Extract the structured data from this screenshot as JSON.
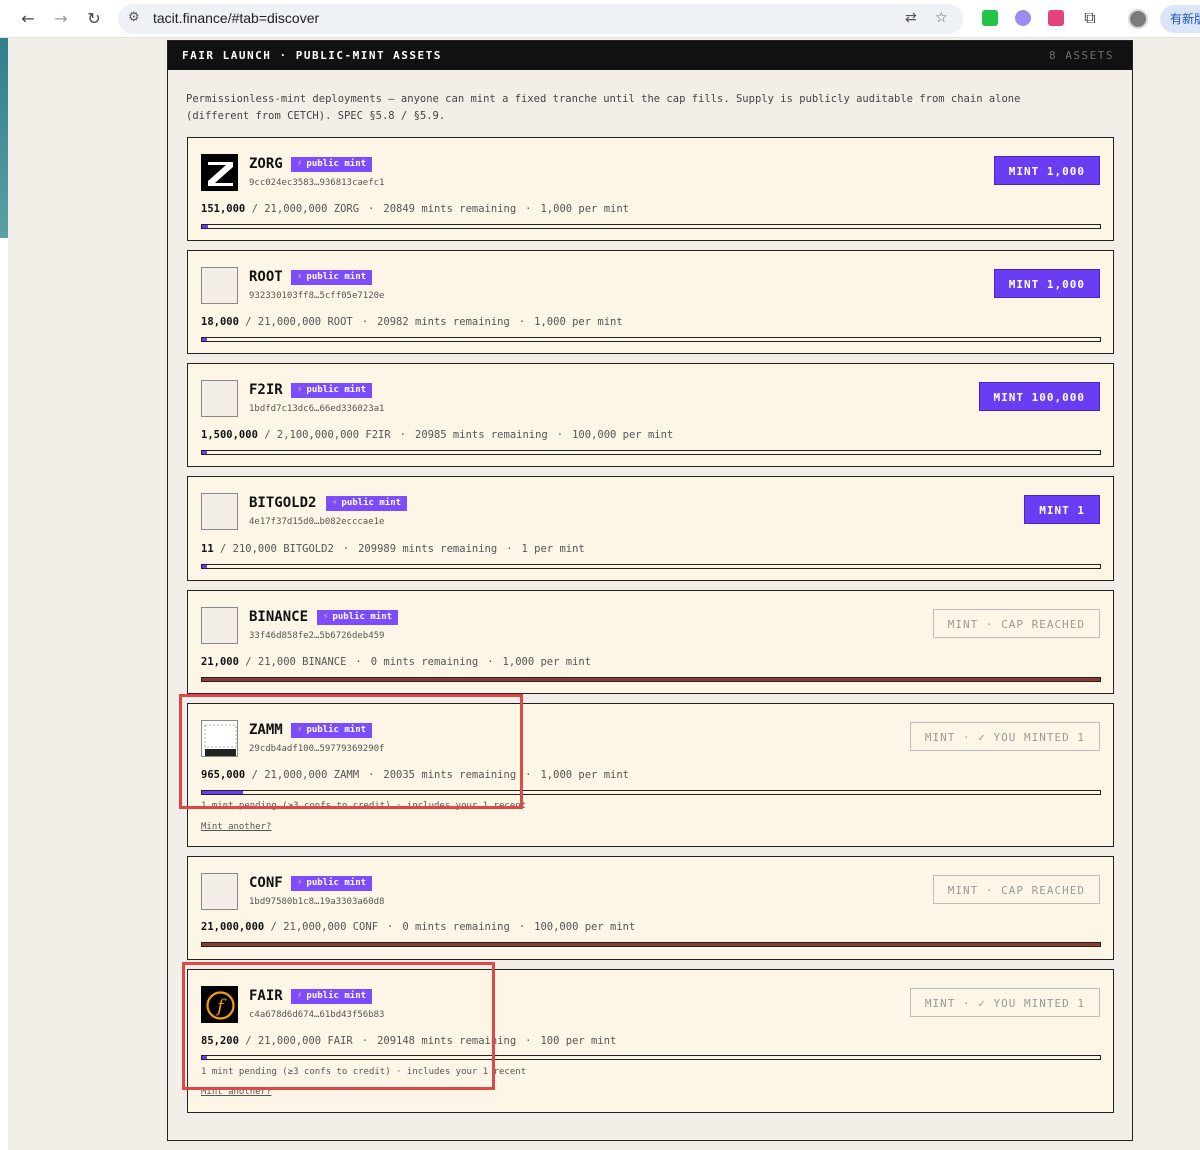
{
  "browser": {
    "url": "tacit.finance/#tab=discover",
    "update_label": "有新版"
  },
  "panel": {
    "title": "FAIR LAUNCH · PUBLIC-MINT ASSETS",
    "count": "8 ASSETS",
    "intro": "Permissionless-mint deployments — anyone can mint a fixed tranche until the cap fills. Supply is publicly auditable from chain alone (different from CETCH). SPEC §5.8 / §5.9."
  },
  "badge_label": "public mint",
  "assets": [
    {
      "ticker": "ZORG",
      "txid": "9cc024ec3583…936813caefc1",
      "minted": "151,000",
      "supply": "/ 21,000,000 ZORG",
      "remaining": "20849 mints remaining",
      "per_mint": "1,000 per mint",
      "button": "MINT 1,000",
      "progress": 0.0072,
      "state": "open"
    },
    {
      "ticker": "ROOT",
      "txid": "932330103ff8…5cff05e7120e",
      "minted": "18,000",
      "supply": "/ 21,000,000 ROOT",
      "remaining": "20982 mints remaining",
      "per_mint": "1,000 per mint",
      "button": "MINT 1,000",
      "progress": 0.0009,
      "state": "open"
    },
    {
      "ticker": "F2IR",
      "txid": "1bdfd7c13dc6…66ed336023a1",
      "minted": "1,500,000",
      "supply": "/ 2,100,000,000 F2IR",
      "remaining": "20985 mints remaining",
      "per_mint": "100,000 per mint",
      "button": "MINT 100,000",
      "progress": 0.0007,
      "state": "open"
    },
    {
      "ticker": "BITGOLD2",
      "txid": "4e17f37d15d0…b082ecccae1e",
      "minted": "11",
      "supply": "/ 210,000 BITGOLD2",
      "remaining": "209989 mints remaining",
      "per_mint": "1 per mint",
      "button": "MINT 1",
      "progress": 0.0001,
      "state": "open"
    },
    {
      "ticker": "BINANCE",
      "txid": "33f46d858fe2…5b6726deb459",
      "minted": "21,000",
      "supply": "/ 21,000 BINANCE",
      "remaining": "0 mints remaining",
      "per_mint": "1,000 per mint",
      "button": "MINT · CAP REACHED",
      "progress": 1,
      "state": "capped"
    },
    {
      "ticker": "ZAMM",
      "txid": "29cdb4adf100…59779369290f",
      "minted": "965,000",
      "supply": "/ 21,000,000 ZAMM",
      "remaining": "20035 mints remaining",
      "per_mint": "1,000 per mint",
      "button": "MINT · ✓ YOU MINTED 1",
      "progress": 0.046,
      "state": "minted",
      "pending": "1 mint pending (≥3 confs to credit) · includes your 1 recent",
      "again": "Mint another?"
    },
    {
      "ticker": "CONF",
      "txid": "1bd97580b1c8…19a3303a60d8",
      "minted": "21,000,000",
      "supply": "/ 21,000,000 CONF",
      "remaining": "0 mints remaining",
      "per_mint": "100,000 per mint",
      "button": "MINT · CAP REACHED",
      "progress": 1,
      "state": "capped"
    },
    {
      "ticker": "FAIR",
      "txid": "c4a678d6d674…61bd43f56b83",
      "minted": "85,200",
      "supply": "/ 21,000,000 FAIR",
      "remaining": "209148 mints remaining",
      "per_mint": "100 per mint",
      "button": "MINT · ✓ YOU MINTED 1",
      "progress": 0.004,
      "state": "minted",
      "pending": "1 mint pending (≥3 confs to credit) · includes your 1 recent",
      "again": "Mint another?"
    }
  ],
  "colors": {
    "accent": "#6a3df2",
    "capped": "#8c3b2f",
    "card_bg": "#fdf6e6",
    "annotation": "#e04848"
  }
}
